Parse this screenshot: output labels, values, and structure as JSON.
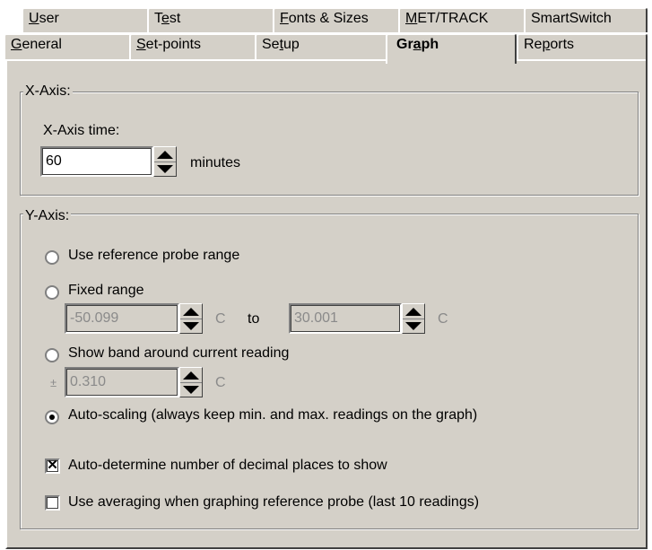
{
  "tabs_row1": [
    {
      "pre": "",
      "u": "U",
      "post": "ser"
    },
    {
      "pre": "T",
      "u": "e",
      "post": "st"
    },
    {
      "pre": "",
      "u": "F",
      "post": "onts & Sizes"
    },
    {
      "pre": "",
      "u": "M",
      "post": "ET/TRACK"
    },
    {
      "pre": "",
      "u": "",
      "post": "SmartSwitch"
    }
  ],
  "tabs_row2": [
    {
      "pre": "",
      "u": "G",
      "post": "eneral"
    },
    {
      "pre": "",
      "u": "S",
      "post": "et-points"
    },
    {
      "pre": "Se",
      "u": "t",
      "post": "up"
    },
    {
      "pre": "Gr",
      "u": "a",
      "post": "ph"
    },
    {
      "pre": "Re",
      "u": "p",
      "post": "orts"
    }
  ],
  "xaxis": {
    "group_title": "X-Axis:",
    "time_label": "X-Axis time:",
    "time_value": "60",
    "time_unit": "minutes"
  },
  "yaxis": {
    "group_title": "Y-Axis:",
    "opt_reference": "Use reference probe range",
    "opt_fixed": "Fixed range",
    "fixed_from": "-50.099",
    "fixed_from_unit": "C",
    "fixed_to_label": "to",
    "fixed_to": "30.001",
    "fixed_to_unit": "C",
    "opt_band": "Show band around current reading",
    "band_prefix": "±",
    "band_value": "0.310",
    "band_unit": "C",
    "opt_auto": "Auto-scaling (always keep min. and max. readings on the graph)",
    "selected_option": "auto"
  },
  "checks": {
    "auto_decimals": "Auto-determine number of decimal places to show",
    "auto_decimals_checked": true,
    "averaging": "Use averaging when graphing reference probe (last 10 readings)",
    "averaging_checked": false
  }
}
